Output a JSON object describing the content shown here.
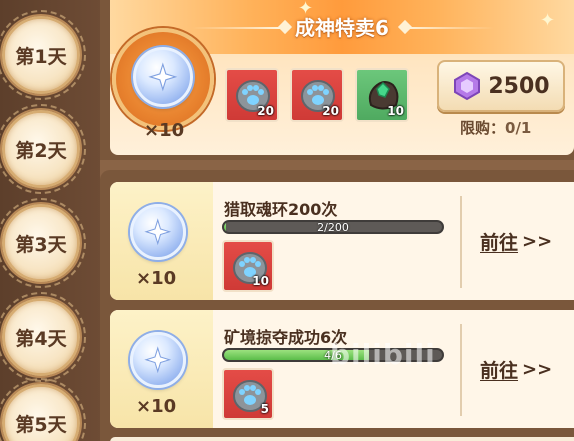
{
  "days": [
    {
      "label": "第1天"
    },
    {
      "label": "第2天"
    },
    {
      "label": "第3天"
    },
    {
      "label": "第4天"
    },
    {
      "label": "第5天"
    }
  ],
  "featured": {
    "title": "成神特卖6",
    "reward_qty": "×10",
    "items": [
      {
        "icon": "paw-stone-icon",
        "count": "20",
        "bg": "#d8413d"
      },
      {
        "icon": "paw-stone-icon",
        "count": "20",
        "bg": "#d8413d"
      },
      {
        "icon": "green-ore-icon",
        "count": "10",
        "bg": "#5cb86b"
      }
    ],
    "price": "2500",
    "limit_label": "限购：",
    "limit_value": "0/1"
  },
  "tasks": [
    {
      "name": "猎取魂环200次",
      "progress_text": "2/200",
      "progress_fraction": 0.01,
      "reward_qty": "×10",
      "item_count": "10",
      "goto_label": "前往",
      "goto_chevron": ">>"
    },
    {
      "name": "矿境掠夺成功6次",
      "progress_text": "4/6",
      "progress_fraction": 0.667,
      "reward_qty": "×10",
      "item_count": "5",
      "goto_label": "前往",
      "goto_chevron": ">>"
    }
  ],
  "watermark": "bilibili",
  "colors": {
    "accent_orange": "#ff9b3c",
    "item_red": "#d8413d",
    "item_green": "#5cb86b",
    "progress_green": "#5bbd4a",
    "text_brown": "#4a3020"
  }
}
